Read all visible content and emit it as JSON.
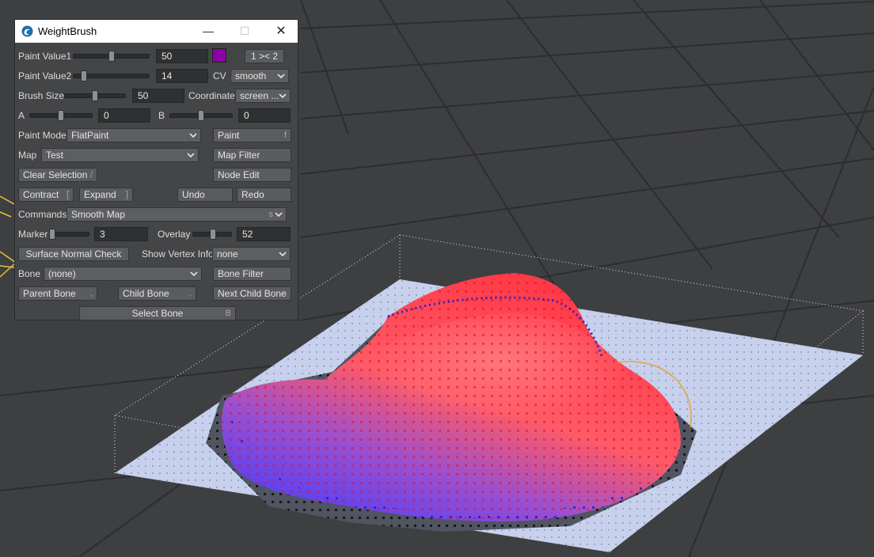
{
  "window": {
    "title": "WeightBrush",
    "icon": "lightwave-logo-icon",
    "controls": {
      "minimize": "—",
      "maximize": "☐",
      "close": "✕"
    }
  },
  "colors": {
    "paint_swatch": "#8c00a8",
    "panel_bg": "#444547",
    "viewport_bg": "#3e3f41",
    "weight_high": "#ff4a55",
    "weight_low": "#3a3aff",
    "ground": "#c7d0ec"
  },
  "paint_value1": {
    "label": "Paint Value1",
    "value": "50",
    "slider": 0.5,
    "swap_button": "1 >< 2"
  },
  "paint_value2": {
    "label": "Paint Value2",
    "value": "14",
    "slider": 0.14,
    "cv_label": "CV",
    "cv_value": "smooth"
  },
  "brush_size": {
    "label": "Brush Size",
    "value": "50",
    "slider": 0.5,
    "coordinate_label": "Coordinate",
    "coordinate_value": "screen ..."
  },
  "a_b": {
    "a_label": "A",
    "a_value": "0",
    "a_slider": 0.5,
    "b_label": "B",
    "b_value": "0",
    "b_slider": 0.5
  },
  "paint_mode": {
    "label": "Paint Mode",
    "value": "FlatPaint",
    "paint_button": "Paint",
    "paint_shortcut": "f"
  },
  "map": {
    "label": "Map",
    "value": "Test",
    "filter_button": "Map Filter"
  },
  "clear_selection": {
    "label": "Clear Selection",
    "shortcut": "/",
    "node_edit": "Node Edit"
  },
  "selection_ops": {
    "contract": "Contract",
    "contract_shortcut": "[",
    "expand": "Expand",
    "expand_shortcut": "]",
    "undo": "Undo",
    "redo": "Redo"
  },
  "commands": {
    "label": "Commands",
    "value": "Smooth Map",
    "shortcut": "s"
  },
  "marker": {
    "label": "Marker",
    "value": "3",
    "slider": 0.03,
    "overlay_label": "Overlay",
    "overlay_value": "52",
    "overlay_slider": 0.52
  },
  "surface": {
    "button": "Surface Normal Check",
    "vertex_label": "Show Vertex Info",
    "vertex_value": "none"
  },
  "bone": {
    "label": "Bone",
    "value": "(none)",
    "filter_button": "Bone Filter",
    "parent": "Parent Bone",
    "parent_shortcut": ",",
    "child": "Child Bone",
    "child_shortcut": ".",
    "next_child": "Next Child Bone",
    "next_child_shortcut": "n",
    "select": "Select Bone",
    "select_shortcut": "B"
  }
}
